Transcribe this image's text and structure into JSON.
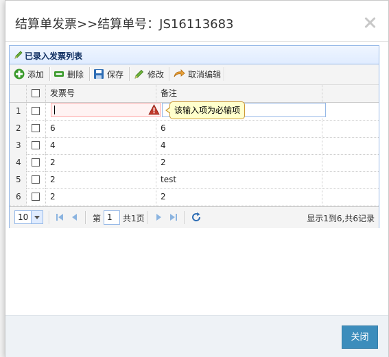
{
  "dialog": {
    "title": "结算单发票>>结算单号：JS16113683",
    "close_button": "关闭"
  },
  "panel": {
    "title": "已录入发票列表"
  },
  "toolbar": {
    "add": "添加",
    "delete": "删除",
    "save": "保存",
    "edit": "修改",
    "cancel_edit": "取消编辑"
  },
  "grid": {
    "columns": [
      "发票号",
      "备注"
    ],
    "editing_row": {
      "row_number": "1",
      "invoice_no": "",
      "note": ""
    },
    "rows": [
      {
        "row_number": "2",
        "invoice_no": "6",
        "note": "6"
      },
      {
        "row_number": "3",
        "invoice_no": "4",
        "note": "4"
      },
      {
        "row_number": "4",
        "invoice_no": "2",
        "note": "2"
      },
      {
        "row_number": "5",
        "invoice_no": "2",
        "note": "test"
      },
      {
        "row_number": "6",
        "invoice_no": "2",
        "note": "2"
      }
    ],
    "validation_tooltip": "该输入项为必输项"
  },
  "pager": {
    "page_size": "10",
    "page_prefix": "第",
    "current_page": "1",
    "total_pages": "共1页",
    "info": "显示1到6,共6记录"
  },
  "colors": {
    "accent": "#3c8dbc",
    "panel_border": "#95b8e7",
    "panel_title": "#0e2d5f",
    "error_bg": "#fff3f3",
    "tooltip_bg": "#ffffcc"
  }
}
